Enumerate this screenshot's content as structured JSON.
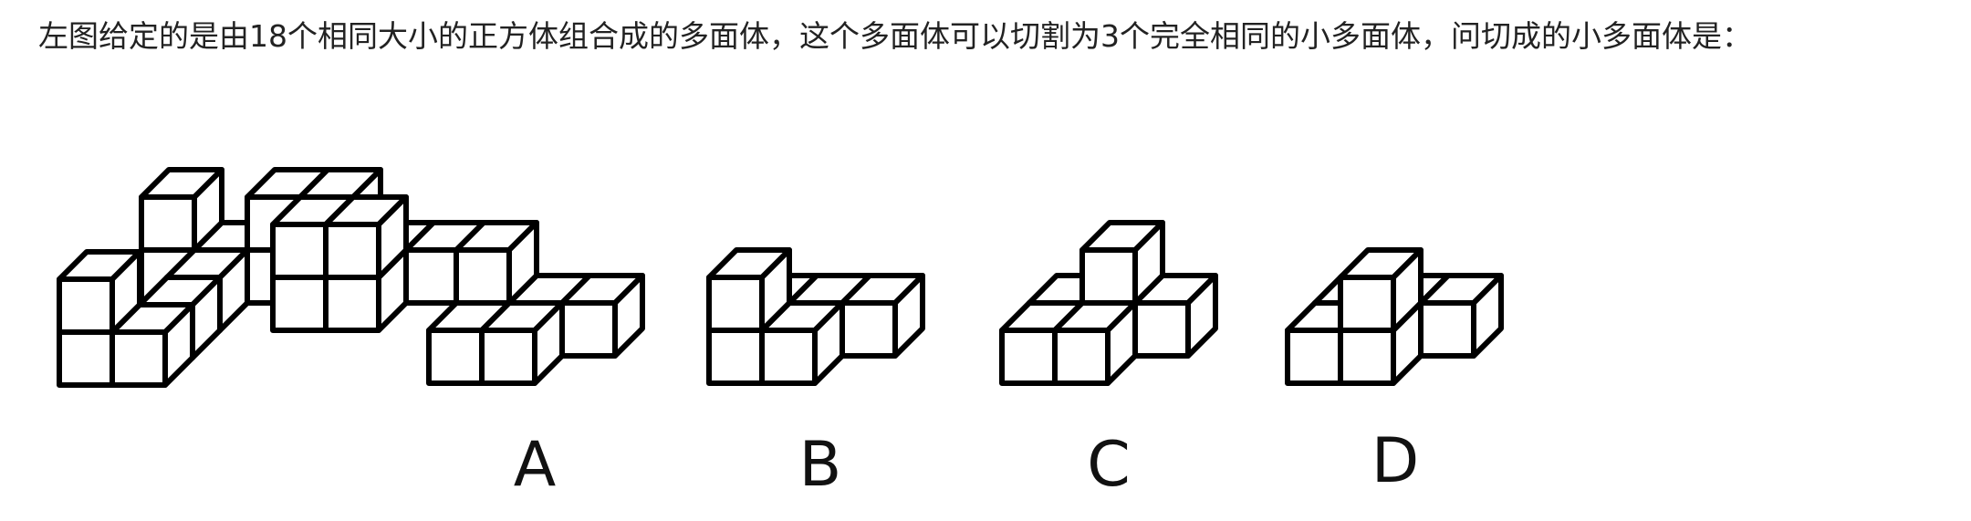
{
  "question": {
    "text": "左图给定的是由18个相同大小的正方体组合成的多面体，这个多面体可以切割为3个完全相同的小多面体，问切成的小多面体是："
  },
  "figures": [
    {
      "id": "main",
      "label": "",
      "cubes": [
        [
          0,
          0,
          0
        ],
        [
          1,
          0,
          0
        ],
        [
          0,
          0,
          1
        ],
        [
          1,
          1,
          0
        ],
        [
          1,
          2,
          0
        ],
        [
          3,
          2,
          0
        ],
        [
          4,
          2,
          0
        ],
        [
          3,
          2,
          1
        ],
        [
          4,
          2,
          1
        ],
        [
          4,
          3,
          0
        ],
        [
          5,
          3,
          0
        ],
        [
          0,
          3,
          0
        ],
        [
          1,
          3,
          0
        ],
        [
          2,
          3,
          0
        ],
        [
          3,
          3,
          0
        ],
        [
          0,
          3,
          1
        ],
        [
          2,
          3,
          1
        ],
        [
          3,
          3,
          1
        ]
      ]
    },
    {
      "id": "option-a",
      "label": "A",
      "cubes": [
        [
          0,
          0,
          0
        ],
        [
          1,
          0,
          0
        ],
        [
          2,
          1,
          0
        ],
        [
          0,
          1,
          0
        ],
        [
          0,
          1,
          1
        ],
        [
          1,
          1,
          0
        ]
      ]
    },
    {
      "id": "option-b",
      "label": "B",
      "cubes": [
        [
          0,
          0,
          0
        ],
        [
          1,
          0,
          0
        ],
        [
          0,
          0,
          1
        ],
        [
          1,
          1,
          0
        ],
        [
          2,
          1,
          0
        ],
        [
          0,
          1,
          0
        ]
      ]
    },
    {
      "id": "option-c",
      "label": "C",
      "cubes": [
        [
          0,
          0,
          0
        ],
        [
          1,
          0,
          0
        ],
        [
          2,
          1,
          0
        ],
        [
          0,
          1,
          0
        ],
        [
          1,
          1,
          0
        ],
        [
          1,
          1,
          1
        ]
      ]
    },
    {
      "id": "option-d",
      "label": "D",
      "cubes": [
        [
          0,
          0,
          0
        ],
        [
          1,
          0,
          0
        ],
        [
          1,
          0,
          1
        ],
        [
          2,
          1,
          0
        ],
        [
          0,
          1,
          0
        ],
        [
          1,
          1,
          0
        ]
      ]
    }
  ]
}
